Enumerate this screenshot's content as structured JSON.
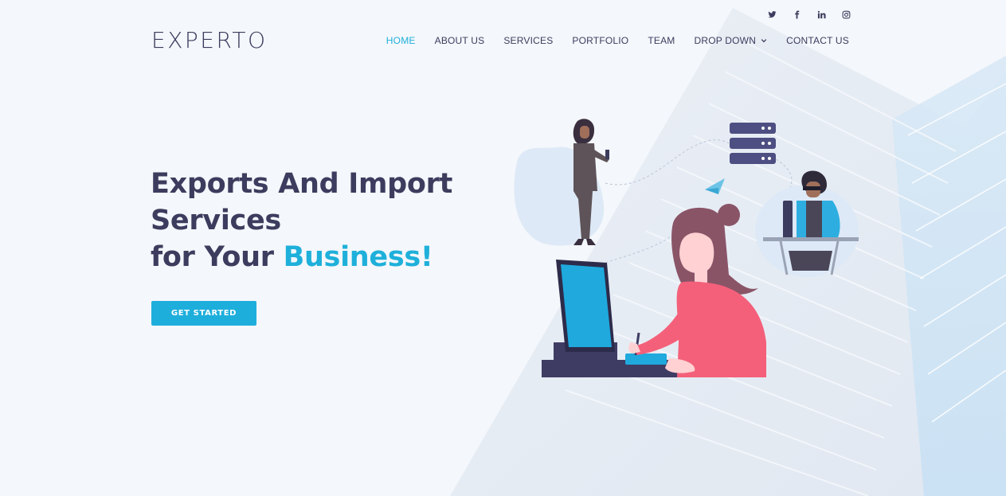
{
  "brand": {
    "logo": "EXPERTO"
  },
  "social": [
    {
      "name": "twitter-icon"
    },
    {
      "name": "facebook-icon"
    },
    {
      "name": "linkedin-icon"
    },
    {
      "name": "instagram-icon"
    }
  ],
  "nav": {
    "items": [
      {
        "label": "HOME",
        "active": true
      },
      {
        "label": "ABOUT US"
      },
      {
        "label": "SERVICES"
      },
      {
        "label": "PORTFOLIO"
      },
      {
        "label": "TEAM"
      },
      {
        "label": "DROP DOWN",
        "has_dropdown": true
      },
      {
        "label": "CONTACT US"
      }
    ]
  },
  "hero": {
    "line1": "Exports And Import",
    "line2": "Services",
    "line3_prefix": "for Your ",
    "line3_accent": "Business!",
    "cta": "GET STARTED"
  },
  "colors": {
    "accent": "#1eb0da",
    "text": "#3c3c5e",
    "background": "#f4f7fb",
    "illustration_pink": "#f4607a",
    "illustration_hair": "#8a5467"
  }
}
